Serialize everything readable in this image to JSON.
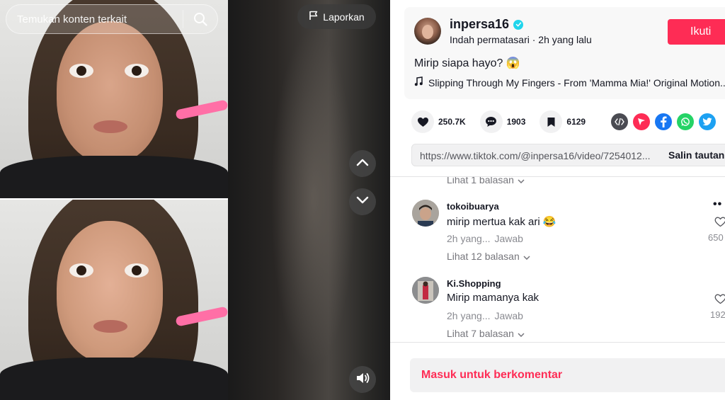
{
  "search": {
    "placeholder": "Temukan konten terkait",
    "icon": "search-icon"
  },
  "video": {
    "report_label": "Laporkan",
    "nav_up_icon": "chevron-up-icon",
    "nav_down_icon": "chevron-down-icon",
    "volume_icon": "speaker-icon"
  },
  "author": {
    "username": "inpersa16",
    "verified": true,
    "display_name": "Indah permatasari",
    "separator": " · ",
    "time_ago": "2h yang lalu",
    "follow_label": "Ikuti"
  },
  "post": {
    "caption": "Mirip siapa hayo? 😱",
    "music": "Slipping Through My Fingers - From 'Mamma Mia!' Original Motion..."
  },
  "stats": {
    "likes": "250.7K",
    "comments": "1903",
    "saves": "6129"
  },
  "share_icons": [
    {
      "name": "embed-icon",
      "color": "#4a4b52"
    },
    {
      "name": "send-icon",
      "color": "#fe2c55"
    },
    {
      "name": "facebook-icon",
      "color": "#1877f2"
    },
    {
      "name": "whatsapp-icon",
      "color": "#25d366"
    },
    {
      "name": "twitter-icon",
      "color": "#1da1f2"
    }
  ],
  "link": {
    "url": "https://www.tiktok.com/@inpersa16/video/7254012...",
    "copy_label": "Salin tautan"
  },
  "comments": {
    "first_replies_label": "Lihat 1 balasan",
    "items": [
      {
        "username": "tokoibuarya",
        "text": "mirip mertua kak ari 😂",
        "time": "2h yang...",
        "reply_label": "Jawab",
        "likes": "650",
        "replies_label": "Lihat 12 balasan"
      },
      {
        "username": "Ki.Shopping",
        "text": "Mirip mamanya kak",
        "time": "2h yang...",
        "reply_label": "Jawab",
        "likes": "192",
        "replies_label": "Lihat 7 balasan"
      }
    ]
  },
  "comment_bar": {
    "login_label": "Masuk untuk berkomentar"
  },
  "colors": {
    "brand": "#fe2c55",
    "verified": "#20d5ec",
    "text": "#161823",
    "muted": "#8a8b91"
  }
}
